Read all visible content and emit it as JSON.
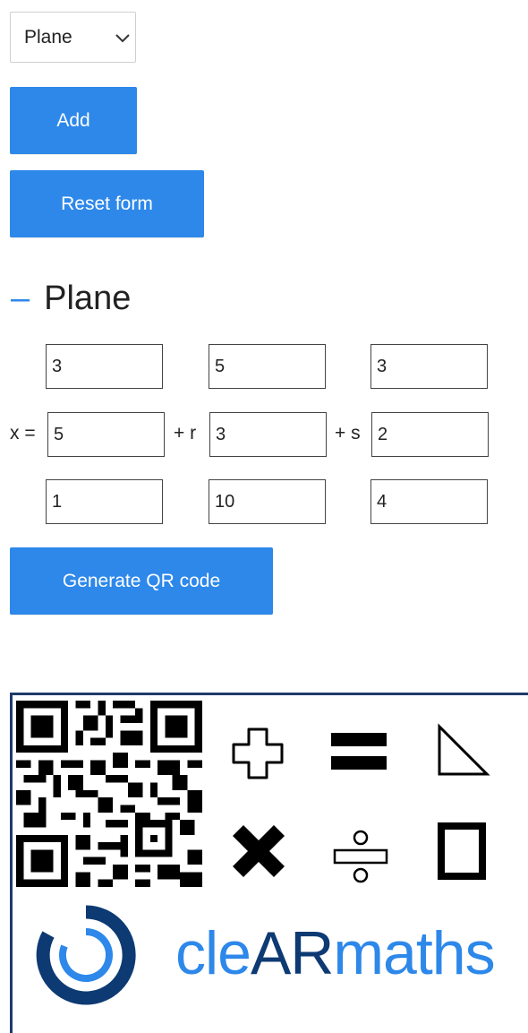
{
  "form": {
    "select_value": "Plane",
    "add_label": "Add",
    "reset_label": "Reset form"
  },
  "section": {
    "collapse_symbol": "–",
    "title": "Plane"
  },
  "equation": {
    "prefix": "x =",
    "r_label": "+ r",
    "s_label": "+ s",
    "point": [
      "3",
      "5",
      "1"
    ],
    "r_vector": [
      "5",
      "3",
      "10"
    ],
    "s_vector": [
      "3",
      "2",
      "4"
    ]
  },
  "qr_button_label": "Generate QR code",
  "branding": {
    "logo_text_part1": "cle",
    "logo_text_part2": "AR",
    "logo_text_part3": "maths",
    "symbols": [
      "plus-outline-icon",
      "equals-icon",
      "triangle-icon",
      "multiply-icon",
      "divide-icon",
      "rectangle-icon"
    ]
  },
  "colors": {
    "accent": "#2d88ea",
    "brand_dark": "#0d3a73"
  }
}
